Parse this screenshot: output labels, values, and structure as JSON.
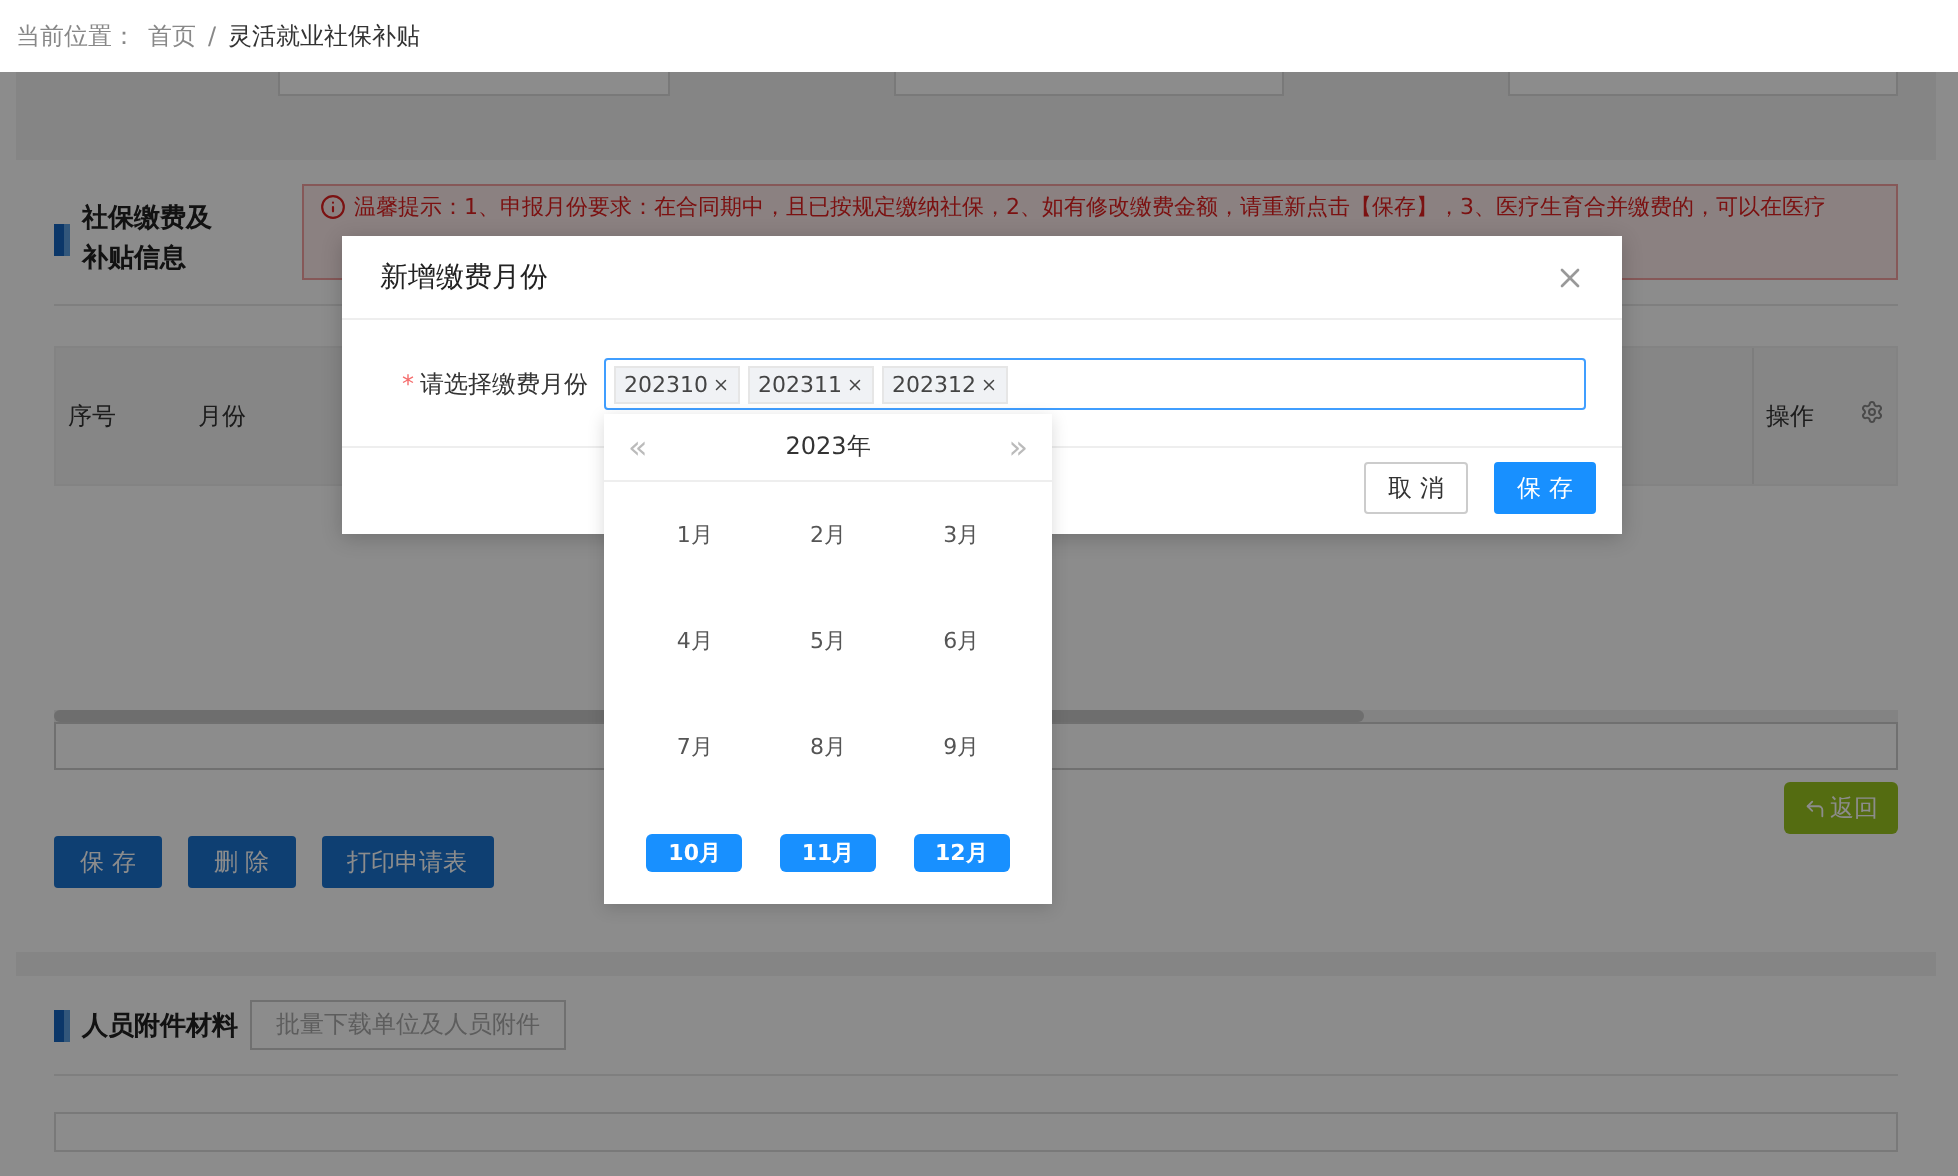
{
  "breadcrumb": {
    "label": "当前位置：",
    "separator": "/",
    "items": [
      {
        "text": "首页"
      },
      {
        "text": "灵活就业社保补贴"
      }
    ]
  },
  "subsidy_section": {
    "title": "社保缴费及补贴信息",
    "notice": "温馨提示：1、申报月份要求：在合同期中，且已按规定缴纳社保，2、如有修改缴费金额，请重新点击【保存】，3、医疗生育合并缴费的，可以在医疗",
    "columns": [
      "序号",
      "月份",
      "操作"
    ],
    "buttons": [
      "保 存",
      "删 除",
      "打印申请表"
    ],
    "return_button": "返回"
  },
  "attachments_section": {
    "title": "人员附件材料",
    "download_button": "批量下载单位及人员附件"
  },
  "dialog": {
    "title": "新增缴费月份",
    "field_label": "请选择缴费月份",
    "required": true,
    "required_mark": "*",
    "tags": [
      "202310",
      "202311",
      "202312"
    ],
    "buttons": [
      {
        "label": "取 消",
        "kind": "default"
      },
      {
        "label": "保 存",
        "kind": "primary"
      }
    ]
  },
  "month_picker": {
    "prev": "«",
    "year": "2023年",
    "next": "»",
    "months": [
      {
        "label": "1月",
        "selected": false
      },
      {
        "label": "2月",
        "selected": false
      },
      {
        "label": "3月",
        "selected": false
      },
      {
        "label": "4月",
        "selected": false
      },
      {
        "label": "5月",
        "selected": false
      },
      {
        "label": "6月",
        "selected": false
      },
      {
        "label": "7月",
        "selected": false
      },
      {
        "label": "8月",
        "selected": false
      },
      {
        "label": "9月",
        "selected": false
      },
      {
        "label": "10月",
        "selected": true
      },
      {
        "label": "11月",
        "selected": true
      },
      {
        "label": "12月",
        "selected": true
      }
    ]
  }
}
